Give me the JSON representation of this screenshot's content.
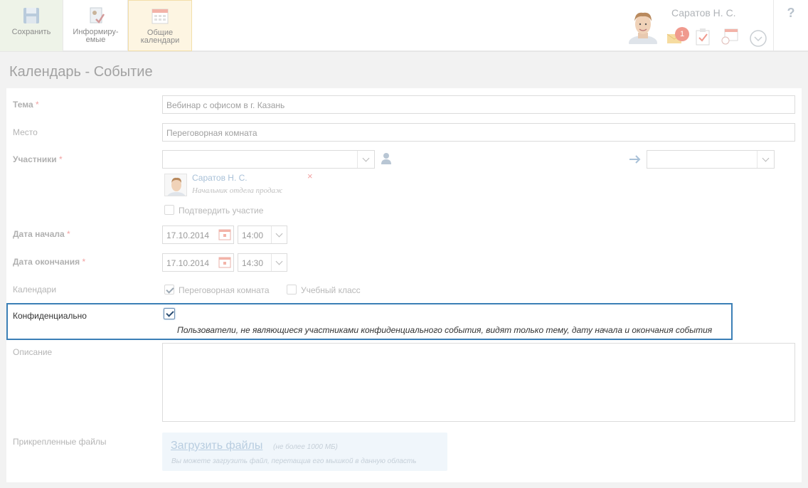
{
  "toolbar": {
    "save_label": "Сохранить",
    "inform_label_1": "Информиру-",
    "inform_label_2": "емые",
    "calendars_label_1": "Общие",
    "calendars_label_2": "календари"
  },
  "user": {
    "name": "Саратов Н. С.",
    "notification_count": "1"
  },
  "help_label": "?",
  "page_title": "Календарь - Событие",
  "form": {
    "subject": {
      "label": "Тема",
      "required_mark": "*",
      "value": "Вебинар с офисом в г. Казань"
    },
    "place": {
      "label": "Место",
      "value": "Переговорная комната"
    },
    "participants": {
      "label": "Участники",
      "required_mark": "*",
      "participant_name": "Саратов Н. С.",
      "participant_role": "Начальник отдела продаж",
      "remove_icon": "×",
      "confirm_label": "Подтвердить участие"
    },
    "start_date": {
      "label": "Дата начала",
      "required_mark": "*",
      "date": "17.10.2014",
      "time": "14:00"
    },
    "end_date": {
      "label": "Дата окончания",
      "required_mark": "*",
      "date": "17.10.2014",
      "time": "14:30"
    },
    "calendars": {
      "label": "Календари",
      "option_1": "Переговорная комната",
      "option_1_checked": true,
      "option_2": "Учебный класс",
      "option_2_checked": false
    },
    "confidential": {
      "label": "Конфиденциально",
      "checked": true,
      "note": "Пользователи, не являющиеся участниками конфиденциального события, видят только тему, дату начала и окончания события"
    },
    "description": {
      "label": "Описание",
      "value": ""
    },
    "attachments": {
      "label": "Прикрепленные файлы",
      "upload_link": "Загрузить файлы",
      "upload_limit": "(не более 1000 МБ)",
      "upload_hint": "Вы можете загрузить файл, перетащив его мышкой в данную область"
    }
  },
  "colors": {
    "accent_border": "#3b7fb6",
    "required_star": "#f2a1a1",
    "link": "#a9c1d8"
  }
}
